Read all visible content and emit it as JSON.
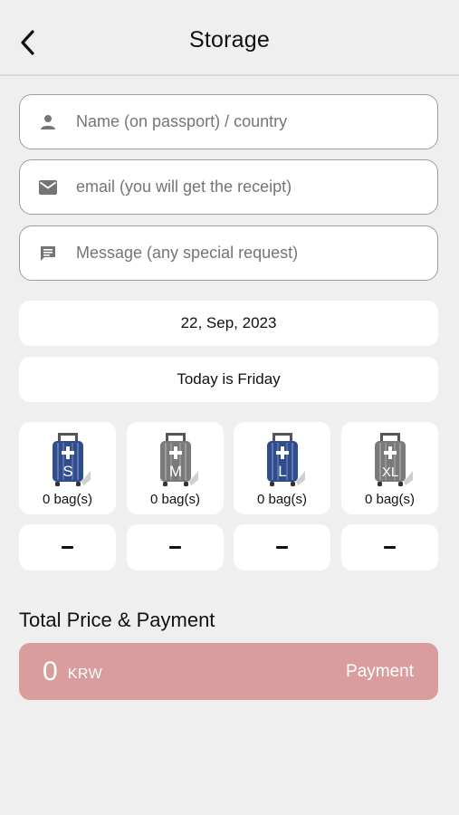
{
  "header": {
    "title": "Storage"
  },
  "form": {
    "name_placeholder": "Name (on passport) / country",
    "email_placeholder": "email (you will get the receipt)",
    "message_placeholder": "Message (any special request)"
  },
  "date": {
    "selected": "22, Sep, 2023",
    "weekday_text": "Today is Friday"
  },
  "bags": [
    {
      "size": "S",
      "count_text": "0 bag(s)",
      "color": "#2f4c8f"
    },
    {
      "size": "M",
      "count_text": "0 bag(s)",
      "color": "#7a7a7a"
    },
    {
      "size": "L",
      "count_text": "0 bag(s)",
      "color": "#2f4c8f"
    },
    {
      "size": "XL",
      "count_text": "0 bag(s)",
      "color": "#7a7a7a"
    }
  ],
  "payment": {
    "section_title": "Total Price & Payment",
    "total": "0",
    "currency": "KRW",
    "button_label": "Payment",
    "accent": "#d99d9d"
  }
}
